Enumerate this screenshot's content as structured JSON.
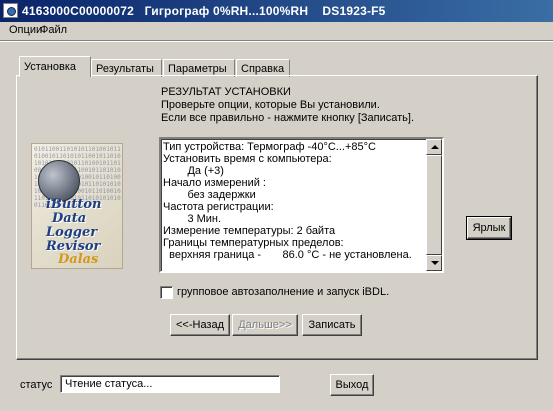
{
  "window": {
    "title": "4163000C00000072   Гигрограф 0%RH...100%RH    DS1923-F5"
  },
  "menu": [
    "Опции",
    "Файл"
  ],
  "tabs": [
    {
      "label": "Установка",
      "active": true
    },
    {
      "label": "Результаты",
      "active": false
    },
    {
      "label": "Параметры",
      "active": false
    },
    {
      "label": "Справка",
      "active": false
    }
  ],
  "logo": {
    "lines": [
      "iButton",
      "Data",
      "Logger",
      "Revisor"
    ],
    "mark": "Dalas",
    "binary": "0101100110101011010010110100101101010110010110101010100110101101001011010010110101011001011010101010011010110100101101001011010101100101101010101001101011010010110100101101010110010110101010100110101101001"
  },
  "result": {
    "heading": "РЕЗУЛЬТАТ УСТАНОВКИ",
    "line1": "Проверьте опции, которые Вы установили.",
    "line2": "Если все правильно - нажмите кнопку [Записать]."
  },
  "settings_lines": [
    "Тип устройства: Термограф -40°C...+85°C",
    "Установить время с компьютера:",
    "        Да (+3)",
    "Начало измерений :",
    "        без задержки",
    "Частота регистрации:",
    "        3 Мин.",
    "Измерение температуры: 2 байта",
    "Границы температурных пределов:",
    "  верхняя граница -       86.0 °C - не установлена."
  ],
  "buttons": {
    "shortcut": "Ярлык",
    "back": "<<-Назад",
    "next": "Дальше>>",
    "write": "Записать",
    "exit": "Выход"
  },
  "checkbox": {
    "label": "групповое автозаполнение и запуск iBDL.",
    "checked": false
  },
  "status": {
    "label": "статус",
    "value": "Чтение статуса..."
  }
}
